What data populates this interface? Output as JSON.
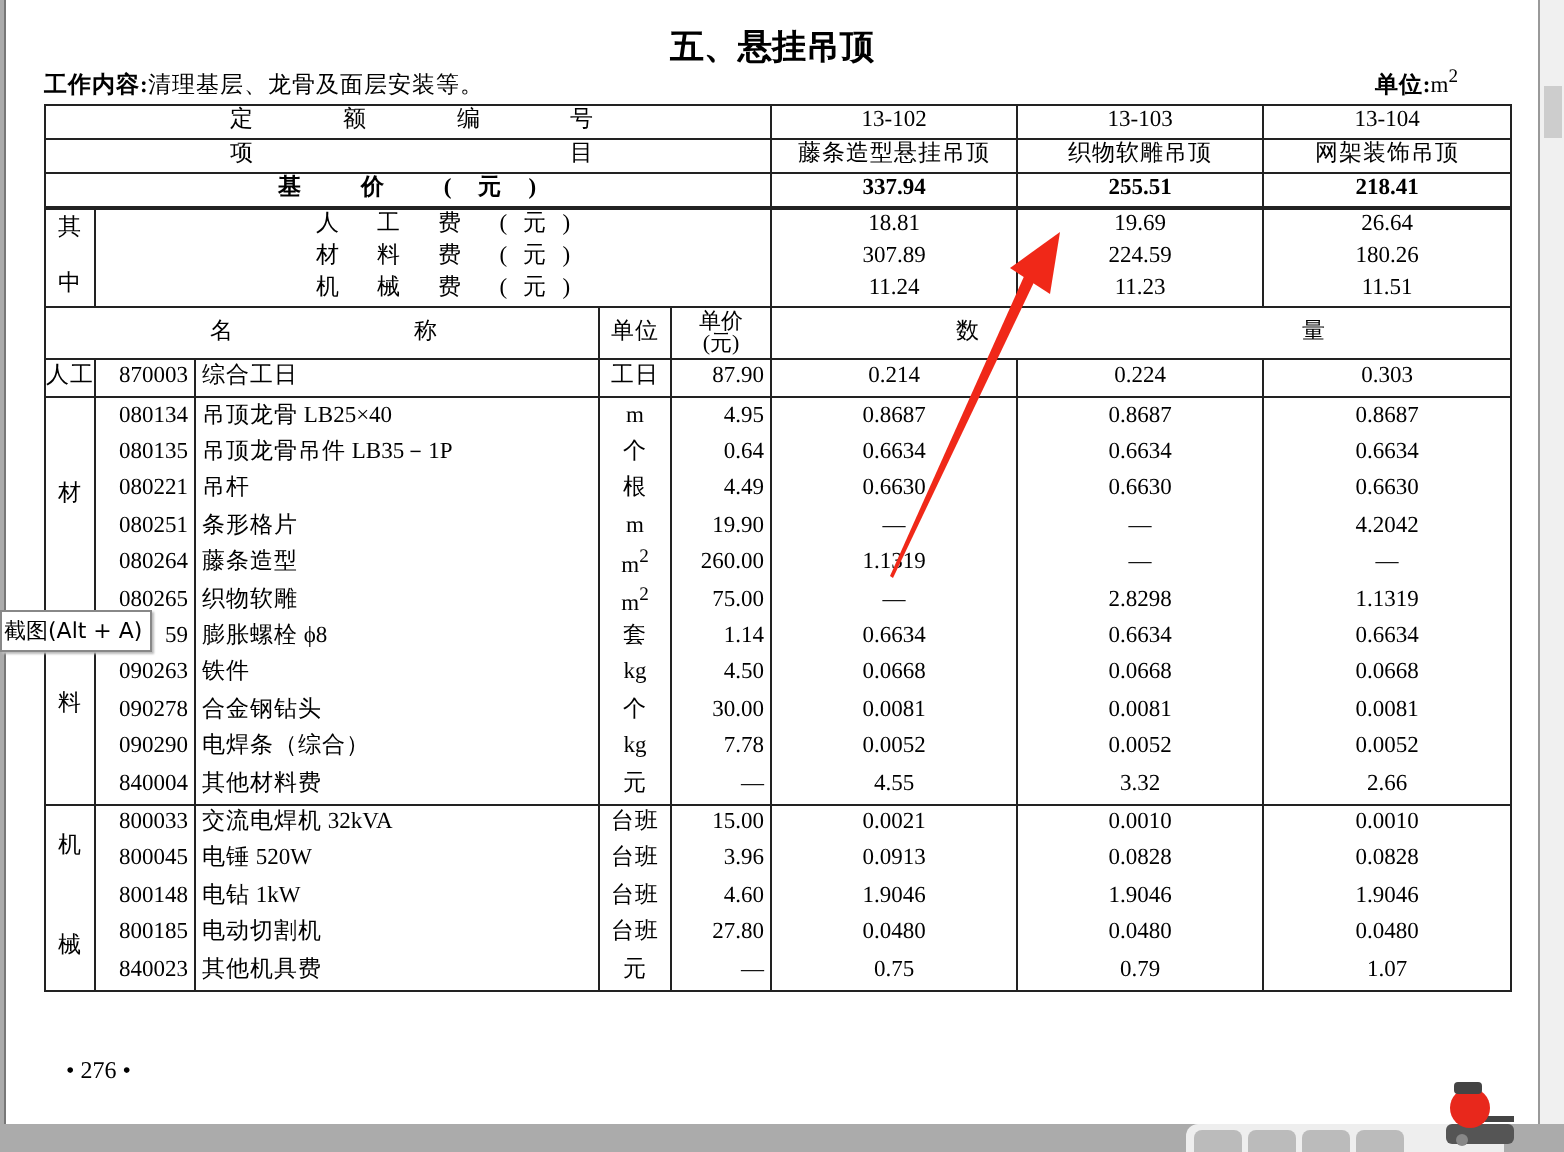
{
  "title": "五、悬挂吊顶",
  "work_content": "**工作内容:**清理基层、龙骨及面层安装等。",
  "unit_note": "**单位:**m$^{2}$",
  "table": {
    "quota_no_label": "定 额 编 号",
    "item_label": "项 目",
    "base_price_label": "基 价 (元)",
    "schemes": [
      {
        "code": "13-102",
        "name": "藤条造型悬挂吊顶",
        "base_price": "337.94"
      },
      {
        "code": "13-103",
        "name": "织物软雕吊顶",
        "base_price": "255.51"
      },
      {
        "code": "13-104",
        "name": "网架装饰吊顶",
        "base_price": "218.41"
      }
    ],
    "breakdown_label": [
      "其",
      "中"
    ],
    "breakdown": [
      {
        "label": "人 工 费 (元)",
        "values": [
          "18.81",
          "19.69",
          "26.64"
        ]
      },
      {
        "label": "材 料 费 (元)",
        "values": [
          "307.89",
          "224.59",
          "180.26"
        ]
      },
      {
        "label": "机 械 费 (元)",
        "values": [
          "11.24",
          "11.23",
          "11.51"
        ]
      }
    ],
    "headers": {
      "name": "名 称",
      "unit": "单位",
      "price": "单价 (元)",
      "quantity": "数 量"
    },
    "groups": [
      {
        "label": [
          "人工"
        ],
        "rows": [
          {
            "code": "870003",
            "name": "综合工日",
            "unit": "工日",
            "price": "87.90",
            "values": [
              "0.214",
              "0.224",
              "0.303"
            ]
          }
        ]
      },
      {
        "label": [
          "材",
          "料"
        ],
        "rows": [
          {
            "code": "080134",
            "name": "吊顶龙骨 LB25×40",
            "unit": "m",
            "price": "4.95",
            "values": [
              "0.8687",
              "0.8687",
              "0.8687"
            ]
          },
          {
            "code": "080135",
            "name": "吊顶龙骨吊件 LB35－1P",
            "unit": "个",
            "price": "0.64",
            "values": [
              "0.6634",
              "0.6634",
              "0.6634"
            ]
          },
          {
            "code": "080221",
            "name": "吊杆",
            "unit": "根",
            "price": "4.49",
            "values": [
              "0.6630",
              "0.6630",
              "0.6630"
            ]
          },
          {
            "code": "080251",
            "name": "条形格片",
            "unit": "m",
            "price": "19.90",
            "values": [
              "—",
              "—",
              "4.2042"
            ]
          },
          {
            "code": "080264",
            "name": "藤条造型",
            "unit": "m$^{2}$",
            "price": "260.00",
            "values": [
              "1.1319",
              "—",
              "—"
            ]
          },
          {
            "code": "080265",
            "name": "织物软雕",
            "unit": "m$^{2}$",
            "price": "75.00",
            "values": [
              "—",
              "2.8298",
              "1.1319"
            ]
          },
          {
            "code": "59",
            "name": "膨胀螺栓 ϕ8",
            "unit": "套",
            "price": "1.14",
            "values": [
              "0.6634",
              "0.6634",
              "0.6634"
            ]
          },
          {
            "code": "090263",
            "name": "铁件",
            "unit": "kg",
            "price": "4.50",
            "values": [
              "0.0668",
              "0.0668",
              "0.0668"
            ]
          },
          {
            "code": "090278",
            "name": "合金钢钻头",
            "unit": "个",
            "price": "30.00",
            "values": [
              "0.0081",
              "0.0081",
              "0.0081"
            ]
          },
          {
            "code": "090290",
            "name": "电焊条（综合）",
            "unit": "kg",
            "price": "7.78",
            "values": [
              "0.0052",
              "0.0052",
              "0.0052"
            ]
          },
          {
            "code": "840004",
            "name": "其他材料费",
            "unit": "元",
            "price": "—",
            "values": [
              "4.55",
              "3.32",
              "2.66"
            ]
          }
        ]
      },
      {
        "label": [
          "机",
          "械"
        ],
        "rows": [
          {
            "code": "800033",
            "name": "交流电焊机 32kVA",
            "unit": "台班",
            "price": "15.00",
            "values": [
              "0.0021",
              "0.0010",
              "0.0010"
            ]
          },
          {
            "code": "800045",
            "name": "电锤 520W",
            "unit": "台班",
            "price": "3.96",
            "values": [
              "0.0913",
              "0.0828",
              "0.0828"
            ]
          },
          {
            "code": "800148",
            "name": "电钻 1kW",
            "unit": "台班",
            "price": "4.60",
            "values": [
              "1.9046",
              "1.9046",
              "1.9046"
            ]
          },
          {
            "code": "800185",
            "name": "电动切割机",
            "unit": "台班",
            "price": "27.80",
            "values": [
              "0.0480",
              "0.0480",
              "0.0480"
            ]
          },
          {
            "code": "840023",
            "name": "其他机具费",
            "unit": "元",
            "price": "—",
            "values": [
              "0.75",
              "0.79",
              "1.07"
            ]
          }
        ]
      }
    ]
  },
  "page_number": "• 276 •",
  "tooltip": "截图(Alt + A)"
}
